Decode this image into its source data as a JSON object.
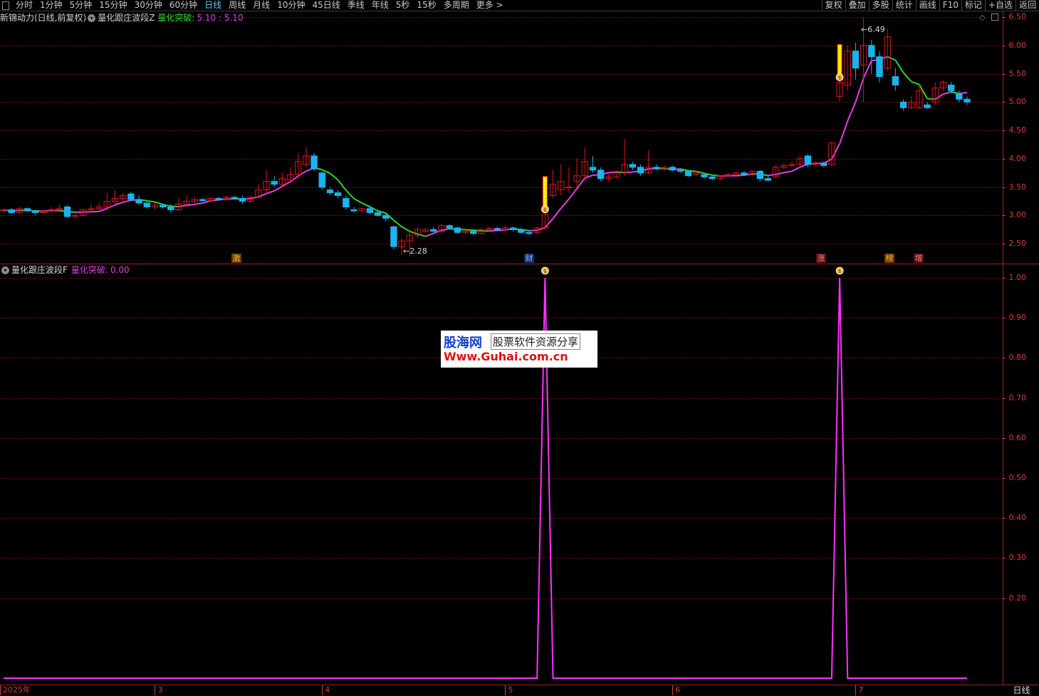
{
  "toolbar": {
    "tabs": [
      "分时",
      "1分钟",
      "5分钟",
      "15分钟",
      "30分钟",
      "60分钟",
      "日线",
      "周线",
      "月线",
      "10分钟",
      "45日线",
      "季线",
      "年线",
      "5秒",
      "15秒",
      "多周期",
      "更多 >"
    ],
    "active_tab": "日线",
    "right_tools": [
      "复权",
      "叠加",
      "多股",
      "统计",
      "画线",
      "F10",
      "标记",
      "+自选",
      "返回"
    ]
  },
  "main_panel": {
    "stock_label": "新锦动力(日线,前复权)",
    "indicator_name": "量化跟庄波段Z",
    "indicator_value_label": "量化突破:",
    "indicator_values": "5.10 : 5.10",
    "high_annotation": "6.49",
    "low_annotation": "2.28",
    "y_ticks": [
      "6.50",
      "6.00",
      "5.50",
      "5.00",
      "4.50",
      "4.00",
      "3.50",
      "3.00",
      "2.50"
    ],
    "event_markers": [
      "激",
      "财",
      "涨",
      "榜",
      "增"
    ]
  },
  "sub_panel": {
    "indicator_name": "量化跟庄波段F",
    "value_label": "量化突破:",
    "value": "0.00",
    "y_ticks": [
      "1.00",
      "0.90",
      "0.80",
      "0.70",
      "0.60",
      "0.50",
      "0.40",
      "0.30",
      "0.20"
    ]
  },
  "x_axis": {
    "labels": [
      "2025年",
      "3",
      "4",
      "5",
      "6",
      "7"
    ],
    "period_label": "日线"
  },
  "watermark": {
    "line1": "股海网",
    "line2": "股票软件资源分享",
    "line3": "Www.Guhai.com.cn"
  },
  "colors": {
    "up": "#e0141e",
    "down": "#19b4f0",
    "ma_up": "#e040e0",
    "ma_down": "#30d030",
    "signal": "#ff30ff",
    "axis": "#d04040"
  },
  "chart_data": [
    {
      "type": "candlestick",
      "title": "量化跟庄波段Z",
      "ylim": [
        2.15,
        6.6
      ],
      "candles": [
        [
          3.08,
          3.1,
          3.05,
          3.12
        ],
        [
          3.1,
          3.05,
          3.03,
          3.13
        ],
        [
          3.05,
          3.12,
          3.02,
          3.15
        ],
        [
          3.12,
          3.08,
          3.06,
          3.14
        ],
        [
          3.08,
          3.05,
          3.0,
          3.1
        ],
        [
          3.05,
          3.08,
          3.02,
          3.1
        ],
        [
          3.08,
          3.1,
          3.05,
          3.15
        ],
        [
          3.1,
          3.12,
          3.05,
          3.2
        ],
        [
          3.15,
          2.98,
          2.96,
          3.18
        ],
        [
          2.98,
          3.0,
          2.95,
          3.05
        ],
        [
          3.0,
          3.1,
          2.98,
          3.12
        ],
        [
          3.1,
          3.12,
          3.08,
          3.2
        ],
        [
          3.12,
          3.15,
          3.1,
          3.22
        ],
        [
          3.15,
          3.25,
          3.12,
          3.4
        ],
        [
          3.25,
          3.3,
          3.2,
          3.45
        ],
        [
          3.3,
          3.35,
          3.25,
          3.4
        ],
        [
          3.38,
          3.28,
          3.25,
          3.42
        ],
        [
          3.28,
          3.22,
          3.2,
          3.35
        ],
        [
          3.22,
          3.15,
          3.12,
          3.25
        ],
        [
          3.15,
          3.18,
          3.1,
          3.22
        ],
        [
          3.18,
          3.15,
          3.12,
          3.2
        ],
        [
          3.15,
          3.1,
          3.05,
          3.2
        ],
        [
          3.1,
          3.2,
          3.08,
          3.3
        ],
        [
          3.2,
          3.25,
          3.15,
          3.35
        ],
        [
          3.25,
          3.28,
          3.22,
          3.32
        ],
        [
          3.28,
          3.26,
          3.24,
          3.3
        ],
        [
          3.26,
          3.3,
          3.25,
          3.32
        ],
        [
          3.3,
          3.28,
          3.26,
          3.33
        ],
        [
          3.28,
          3.32,
          3.25,
          3.35
        ],
        [
          3.32,
          3.3,
          3.28,
          3.34
        ],
        [
          3.3,
          3.25,
          3.2,
          3.35
        ],
        [
          3.25,
          3.32,
          3.22,
          3.35
        ],
        [
          3.32,
          3.45,
          3.3,
          3.55
        ],
        [
          3.45,
          3.6,
          3.4,
          3.8
        ],
        [
          3.6,
          3.55,
          3.5,
          3.7
        ],
        [
          3.55,
          3.65,
          3.5,
          3.75
        ],
        [
          3.62,
          3.72,
          3.58,
          3.85
        ],
        [
          3.72,
          3.95,
          3.65,
          4.1
        ],
        [
          3.9,
          4.05,
          3.85,
          4.2
        ],
        [
          4.05,
          3.82,
          3.78,
          4.1
        ],
        [
          3.75,
          3.5,
          3.45,
          3.78
        ],
        [
          3.45,
          3.4,
          3.35,
          3.5
        ],
        [
          3.4,
          3.35,
          3.3,
          3.45
        ],
        [
          3.3,
          3.15,
          3.1,
          3.35
        ],
        [
          3.1,
          3.08,
          3.05,
          3.15
        ],
        [
          3.08,
          3.12,
          3.05,
          3.15
        ],
        [
          3.12,
          3.05,
          3.02,
          3.18
        ],
        [
          3.05,
          3.0,
          2.98,
          3.1
        ],
        [
          3.0,
          2.95,
          2.9,
          3.05
        ],
        [
          2.8,
          2.45,
          2.4,
          2.82
        ],
        [
          2.45,
          2.55,
          2.3,
          2.6
        ],
        [
          2.55,
          2.65,
          2.28,
          2.7
        ],
        [
          2.65,
          2.75,
          2.6,
          2.8
        ],
        [
          2.72,
          2.75,
          2.68,
          2.78
        ],
        [
          2.75,
          2.72,
          2.7,
          2.8
        ],
        [
          2.72,
          2.82,
          2.7,
          2.85
        ],
        [
          2.82,
          2.78,
          2.75,
          2.85
        ],
        [
          2.78,
          2.7,
          2.68,
          2.8
        ],
        [
          2.7,
          2.72,
          2.68,
          2.75
        ],
        [
          2.72,
          2.68,
          2.66,
          2.75
        ],
        [
          2.68,
          2.75,
          2.66,
          2.78
        ],
        [
          2.75,
          2.77,
          2.72,
          2.8
        ],
        [
          2.77,
          2.75,
          2.72,
          2.8
        ],
        [
          2.75,
          2.78,
          2.72,
          2.82
        ],
        [
          2.78,
          2.75,
          2.72,
          2.8
        ],
        [
          2.75,
          2.7,
          2.68,
          2.78
        ],
        [
          2.7,
          2.68,
          2.65,
          2.72
        ],
        [
          2.7,
          2.78,
          2.68,
          2.8
        ],
        [
          2.78,
          3.02,
          2.75,
          3.05
        ],
        [
          3.35,
          3.55,
          3.3,
          3.8
        ],
        [
          3.45,
          3.6,
          3.35,
          3.9
        ],
        [
          3.5,
          3.5,
          3.4,
          3.85
        ],
        [
          3.6,
          3.7,
          3.5,
          4.0
        ],
        [
          3.7,
          3.95,
          3.6,
          4.2
        ],
        [
          3.85,
          3.8,
          3.75,
          4.05
        ],
        [
          3.8,
          3.65,
          3.6,
          3.85
        ],
        [
          3.65,
          3.68,
          3.6,
          3.75
        ],
        [
          3.68,
          3.75,
          3.65,
          3.8
        ],
        [
          3.75,
          3.9,
          3.7,
          4.35
        ],
        [
          3.9,
          3.85,
          3.8,
          3.95
        ],
        [
          3.85,
          3.75,
          3.7,
          3.9
        ],
        [
          3.75,
          3.85,
          3.72,
          4.15
        ],
        [
          3.85,
          3.82,
          3.8,
          3.9
        ],
        [
          3.82,
          3.85,
          3.8,
          3.88
        ],
        [
          3.85,
          3.8,
          3.78,
          3.88
        ],
        [
          3.8,
          3.78,
          3.75,
          3.82
        ],
        [
          3.78,
          3.7,
          3.68,
          3.8
        ],
        [
          3.72,
          3.75,
          3.7,
          3.78
        ],
        [
          3.72,
          3.68,
          3.65,
          3.75
        ],
        [
          3.68,
          3.65,
          3.62,
          3.7
        ],
        [
          3.65,
          3.7,
          3.63,
          3.72
        ],
        [
          3.7,
          3.72,
          3.68,
          3.75
        ],
        [
          3.72,
          3.75,
          3.7,
          3.77
        ],
        [
          3.75,
          3.72,
          3.7,
          3.78
        ],
        [
          3.72,
          3.78,
          3.7,
          3.8
        ],
        [
          3.78,
          3.65,
          3.6,
          3.8
        ],
        [
          3.65,
          3.62,
          3.6,
          3.7
        ],
        [
          3.68,
          3.85,
          3.65,
          3.9
        ],
        [
          3.85,
          3.88,
          3.82,
          3.92
        ],
        [
          3.88,
          3.9,
          3.85,
          3.95
        ],
        [
          3.9,
          4.0,
          3.88,
          4.05
        ],
        [
          4.05,
          3.9,
          3.85,
          4.08
        ],
        [
          3.9,
          3.92,
          3.88,
          3.95
        ],
        [
          3.92,
          3.88,
          3.85,
          3.95
        ],
        [
          3.9,
          4.28,
          3.88,
          4.3
        ],
        [
          5.1,
          5.35,
          5.0,
          5.4
        ],
        [
          5.3,
          5.9,
          5.2,
          6.0
        ],
        [
          5.9,
          5.6,
          5.4,
          6.05
        ],
        [
          5.65,
          6.0,
          5.0,
          6.49
        ],
        [
          6.0,
          5.8,
          5.5,
          6.1
        ],
        [
          5.8,
          5.45,
          5.35,
          5.9
        ],
        [
          5.6,
          6.15,
          5.55,
          6.3
        ],
        [
          5.45,
          5.3,
          5.2,
          5.6
        ],
        [
          5.0,
          4.9,
          4.85,
          5.05
        ],
        [
          4.9,
          5.0,
          4.88,
          5.1
        ],
        [
          4.9,
          5.2,
          4.88,
          5.3
        ],
        [
          4.95,
          4.9,
          4.88,
          5.0
        ],
        [
          5.0,
          5.25,
          4.95,
          5.35
        ],
        [
          5.25,
          5.35,
          5.2,
          5.38
        ],
        [
          5.3,
          5.2,
          5.15,
          5.35
        ],
        [
          5.15,
          5.05,
          5.0,
          5.2
        ],
        [
          5.05,
          5.0,
          4.95,
          5.1
        ]
      ]
    },
    {
      "type": "line",
      "title": "量化跟庄波段F",
      "ylim": [
        0.0,
        1.0
      ],
      "values": [
        0,
        0,
        0,
        0,
        0,
        0,
        0,
        0,
        0,
        0,
        0,
        0,
        0,
        0,
        0,
        0,
        0,
        0,
        0,
        0,
        0,
        0,
        0,
        0,
        0,
        0,
        0,
        0,
        0,
        0,
        0,
        0,
        0,
        0,
        0,
        0,
        0,
        0,
        0,
        0,
        0,
        0,
        0,
        0,
        0,
        0,
        0,
        0,
        0,
        0,
        0,
        0,
        0,
        0,
        0,
        0,
        0,
        0,
        0,
        0,
        0,
        0,
        0,
        0,
        0,
        0,
        0,
        0,
        1,
        0,
        0,
        0,
        0,
        0,
        0,
        0,
        0,
        0,
        0,
        0,
        0,
        0,
        0,
        0,
        0,
        0,
        0,
        0,
        0,
        0,
        0,
        0,
        0,
        0,
        0,
        0,
        0,
        0,
        0,
        0,
        0,
        0,
        0,
        0,
        0,
        1,
        0,
        0,
        0,
        0,
        0,
        0,
        0,
        0,
        0,
        0,
        0,
        0,
        0,
        0,
        0,
        0
      ]
    }
  ]
}
